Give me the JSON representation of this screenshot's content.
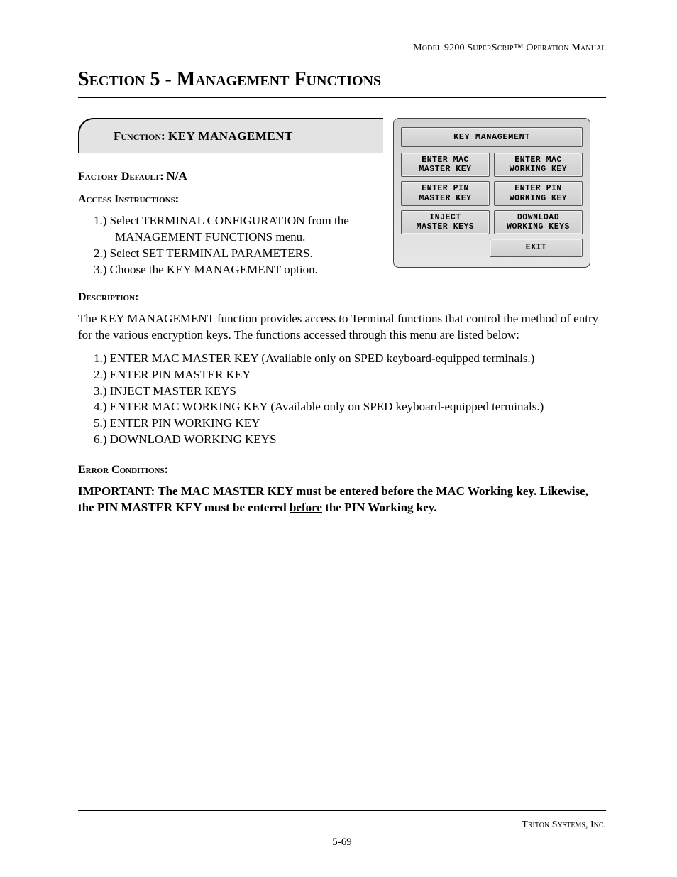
{
  "header": "Model 9200 SuperScrip™ Operation Manual",
  "section_title": "Section 5 - Management Functions",
  "function_label": "Function:  ",
  "function_name": "KEY MANAGEMENT",
  "factory_default_label": "Factory Default: ",
  "factory_default_value": "N/A",
  "access_label": "Access Instructions:",
  "access_steps": {
    "s1a": "1.) Select TERMINAL CONFIGURATION from the",
    "s1b": "MANAGEMENT FUNCTIONS menu.",
    "s2": "2.) Select SET TERMINAL PARAMETERS.",
    "s3": "3.) Choose the KEY MANAGEMENT option."
  },
  "description_label": "Description:",
  "description_text": "The KEY MANAGEMENT function provides access to Terminal functions that control the method of entry for the various encryption keys. The functions accessed through this menu are listed below:",
  "description_list": {
    "d1": "1.) ENTER MAC MASTER KEY  (Available only on SPED keyboard-equipped terminals.)",
    "d2": "2.) ENTER PIN MASTER KEY",
    "d3": "3.) INJECT MASTER KEYS",
    "d4": "4.) ENTER MAC WORKING KEY (Available only on SPED keyboard-equipped terminals.)",
    "d5": "5.) ENTER PIN WORKING  KEY",
    "d6": "6.) DOWNLOAD WORKING KEYS"
  },
  "error_label": "Error Conditions:",
  "important_pre": "IMPORTANT: The MAC MASTER KEY must be entered ",
  "important_u1": "before",
  "important_mid": " the MAC Working key. Likewise, the PIN MASTER KEY must be entered ",
  "important_u2": "before",
  "important_post": " the PIN Working key.",
  "screen": {
    "title": "KEY MANAGEMENT",
    "b1": "ENTER MAC\nMASTER KEY",
    "b2": "ENTER MAC\nWORKING KEY",
    "b3": "ENTER PIN\nMASTER KEY",
    "b4": "ENTER PIN\nWORKING KEY",
    "b5": "INJECT\nMASTER KEYS",
    "b6": "DOWNLOAD\nWORKING KEYS",
    "exit": "EXIT"
  },
  "footer_company": "Triton Systems, Inc.",
  "footer_page": "5-69"
}
